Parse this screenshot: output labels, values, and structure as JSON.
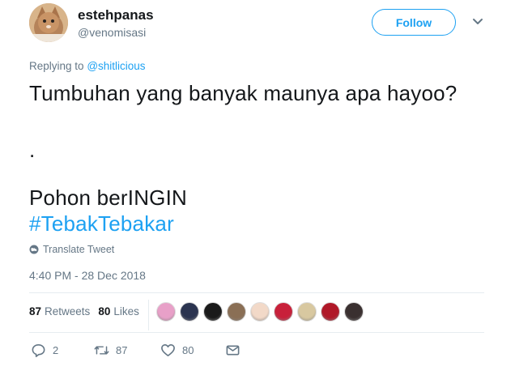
{
  "user": {
    "display_name": "estehpanas",
    "handle": "@venomisasi",
    "follow_label": "Follow"
  },
  "reply": {
    "prefix": "Replying to",
    "mention": "@shitlicious"
  },
  "body": {
    "line1": "Tumbuhan yang banyak maunya apa hayoo?",
    "line2": ".",
    "line3": "Pohon berINGIN",
    "hashtag": "#TebakTebakar"
  },
  "translate_label": "Translate Tweet",
  "timestamp": "4:40 PM - 28 Dec 2018",
  "stats": {
    "retweets_count": "87",
    "retweets_label": "Retweets",
    "likes_count": "80",
    "likes_label": "Likes"
  },
  "liker_colors": [
    "#e8a0c8",
    "#2b3450",
    "#1a1a1a",
    "#8a6f55",
    "#f2d9c8",
    "#c8203a",
    "#d8c8a0",
    "#b01828",
    "#3a3030"
  ],
  "actions": {
    "replies": "2",
    "retweets": "87",
    "likes": "80"
  },
  "colors": {
    "accent": "#1da1f2",
    "muted": "#657786",
    "text": "#14171a"
  }
}
